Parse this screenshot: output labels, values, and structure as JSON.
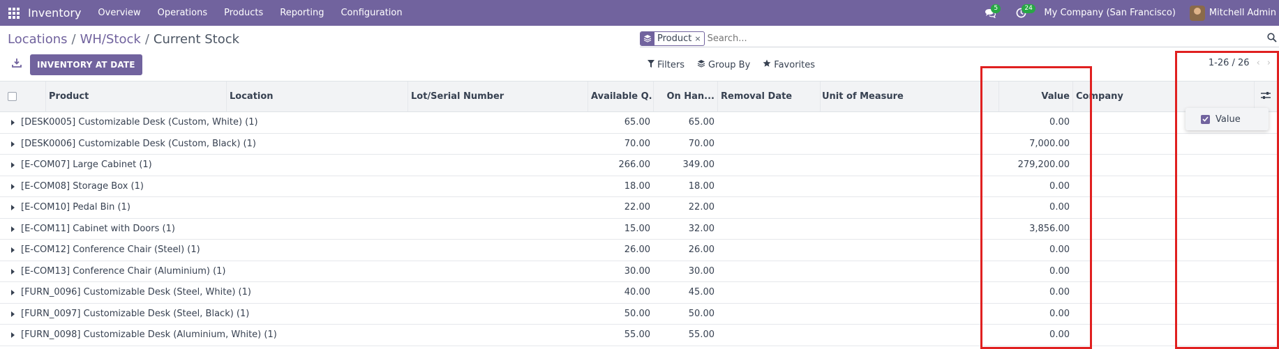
{
  "navbar": {
    "app_name": "Inventory",
    "menu": [
      "Overview",
      "Operations",
      "Products",
      "Reporting",
      "Configuration"
    ],
    "messages_count": "5",
    "activities_count": "24",
    "company": "My Company (San Francisco)",
    "user": "Mitchell Admin"
  },
  "breadcrumb": {
    "items": [
      "Locations",
      "WH/Stock",
      "Current Stock"
    ],
    "separator": "/"
  },
  "search": {
    "facet_label": "Product",
    "facet_remove": "×",
    "placeholder": "Search..."
  },
  "toolbar": {
    "inventory_at_date_label": "INVENTORY AT DATE",
    "filters_label": "Filters",
    "group_by_label": "Group By",
    "favorites_label": "Favorites"
  },
  "pager": {
    "value": "1-26 / 26",
    "prev": "‹",
    "next": "›"
  },
  "table": {
    "columns": {
      "product": "Product",
      "location": "Location",
      "lot": "Lot/Serial Number",
      "available": "Available Q...",
      "on_hand": "On Han...",
      "removal_date": "Removal Date",
      "uom": "Unit of Measure",
      "value": "Value",
      "company": "Company"
    },
    "rows": [
      {
        "product": "[DESK0005] Customizable Desk (Custom, White) (1)",
        "available": "65.00",
        "on_hand": "65.00",
        "value": "0.00"
      },
      {
        "product": "[DESK0006] Customizable Desk (Custom, Black) (1)",
        "available": "70.00",
        "on_hand": "70.00",
        "value": "7,000.00"
      },
      {
        "product": "[E-COM07] Large Cabinet (1)",
        "available": "266.00",
        "on_hand": "349.00",
        "value": "279,200.00"
      },
      {
        "product": "[E-COM08] Storage Box (1)",
        "available": "18.00",
        "on_hand": "18.00",
        "value": "0.00"
      },
      {
        "product": "[E-COM10] Pedal Bin (1)",
        "available": "22.00",
        "on_hand": "22.00",
        "value": "0.00"
      },
      {
        "product": "[E-COM11] Cabinet with Doors (1)",
        "available": "15.00",
        "on_hand": "32.00",
        "value": "3,856.00"
      },
      {
        "product": "[E-COM12] Conference Chair (Steel) (1)",
        "available": "26.00",
        "on_hand": "26.00",
        "value": "0.00"
      },
      {
        "product": "[E-COM13] Conference Chair (Aluminium) (1)",
        "available": "30.00",
        "on_hand": "30.00",
        "value": "0.00"
      },
      {
        "product": "[FURN_0096] Customizable Desk (Steel, White) (1)",
        "available": "40.00",
        "on_hand": "45.00",
        "value": "0.00"
      },
      {
        "product": "[FURN_0097] Customizable Desk (Steel, Black) (1)",
        "available": "50.00",
        "on_hand": "50.00",
        "value": "0.00"
      },
      {
        "product": "[FURN_0098] Customizable Desk (Aluminium, White) (1)",
        "available": "55.00",
        "on_hand": "55.00",
        "value": "0.00"
      }
    ]
  },
  "optional_columns": {
    "items": [
      {
        "label": "Value",
        "checked": true
      }
    ]
  },
  "colors": {
    "brand": "#71639e",
    "badge": "#28a745",
    "highlight": "#e02020"
  }
}
